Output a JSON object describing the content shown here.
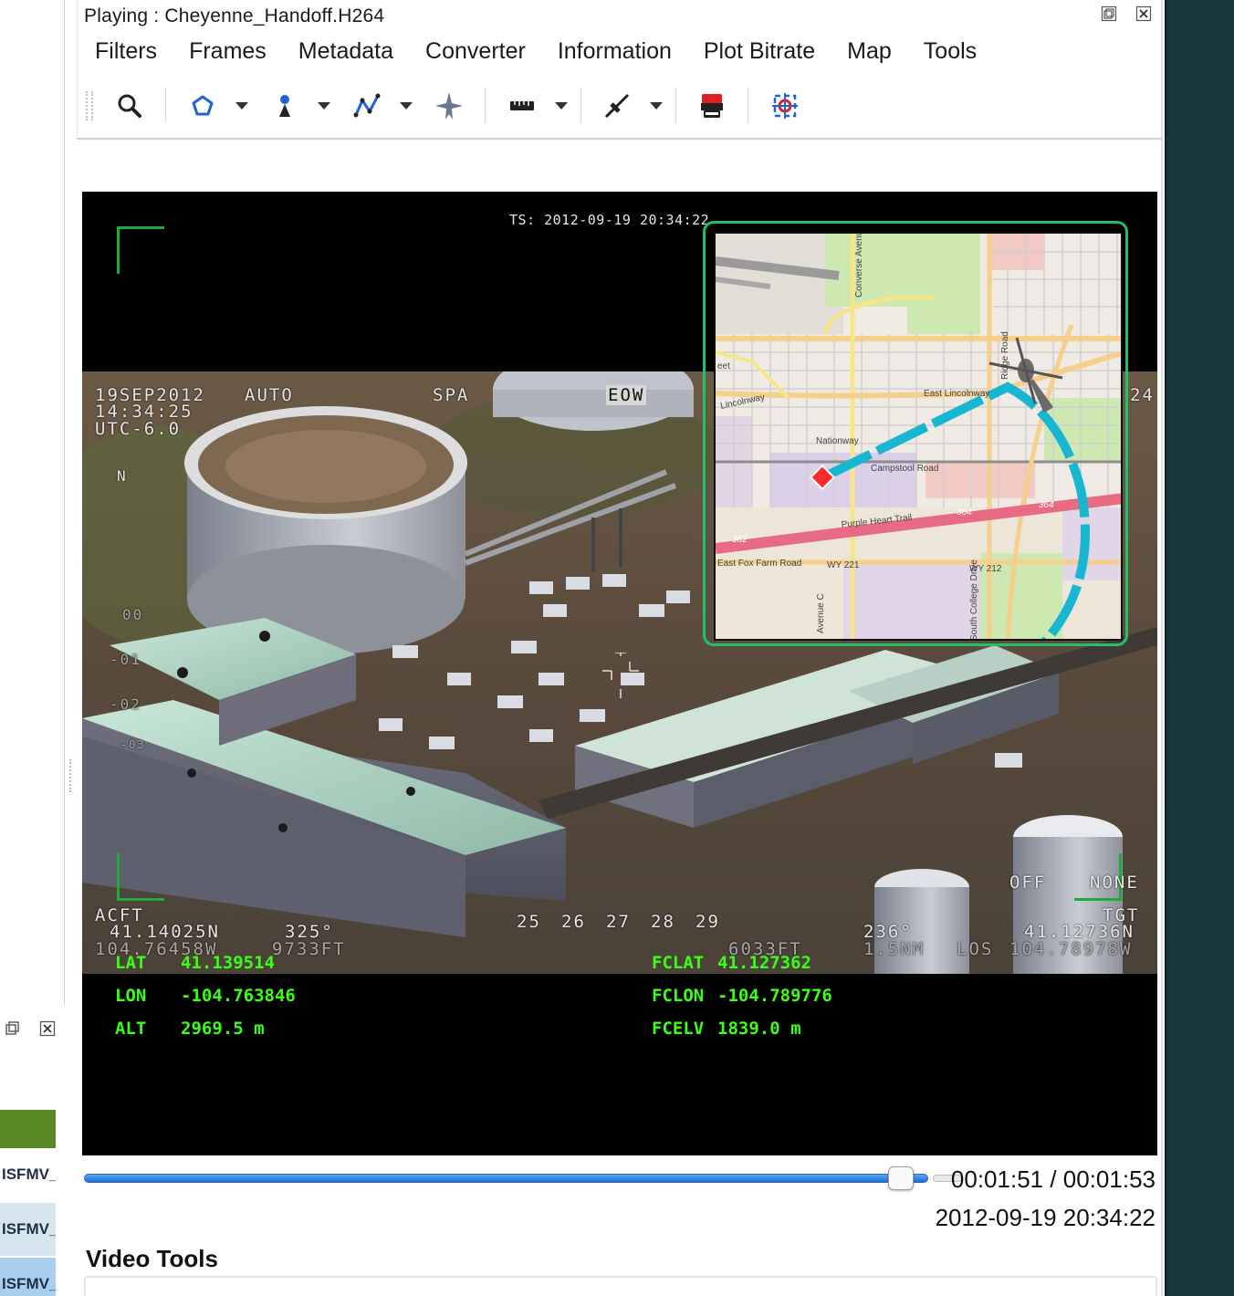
{
  "window": {
    "title": "Playing : Cheyenne_Handoff.H264",
    "restore_icon": "restore-icon",
    "close_icon": "close-icon"
  },
  "menu": [
    "Filters",
    "Frames",
    "Metadata",
    "Converter",
    "Information",
    "Plot Bitrate",
    "Map",
    "Tools"
  ],
  "toolbar": {
    "icons": [
      "magnifier-icon",
      "polygon-icon",
      "point-icon",
      "polyline-icon",
      "aircraft-icon",
      "ruler-icon",
      "line-tool-icon",
      "capture-icon",
      "crosshair-target-icon"
    ]
  },
  "osd": {
    "ts": "TS: 2012-09-19 20:34:22",
    "date": "19SEP2012",
    "mode": "AUTO",
    "time": "14:34:25",
    "utc": "UTC-6.0",
    "spa": "SPA",
    "sensor": "EOW",
    "right_edge": "24",
    "north": "N",
    "scale": [
      "00",
      "-01",
      "-02",
      "-03"
    ],
    "heading_ticks": [
      "25",
      "26",
      "27",
      "28",
      "29"
    ],
    "off": "OFF",
    "none": "NONE",
    "acft_label": "ACFT",
    "acft_lat": "41.14025N",
    "acft_lon": "104.76458W",
    "acft_heading": "325°",
    "acft_alt": "9733FT",
    "tgt_alt": "6033FT",
    "tgt_bearing": "236°",
    "tgt_range": "1.5NM",
    "los": "LOS",
    "tgt_label": "TGT",
    "tgt_lat": "41.12736N",
    "tgt_lon": "104.78978W"
  },
  "klv": {
    "lat_label": "LAT",
    "lat_value": "41.139514",
    "lon_label": "LON",
    "lon_value": "-104.763846",
    "alt_label": "ALT",
    "alt_value": "2969.5 m",
    "fclat_label": "FCLAT",
    "fclat_value": "41.127362",
    "fclon_label": "FCLON",
    "fclon_value": "-104.789776",
    "fcelv_label": "FCELV",
    "fcelv_value": "1839.0 m"
  },
  "minimap": {
    "streets": [
      "Converse Avenue",
      "Ridge Road",
      "East Lincolnway",
      "Lincolnway",
      "Nationway",
      "Campstool Road",
      "Purple Heart Trail",
      "East Fox Farm Road",
      "WY 221",
      "WY 212",
      "South College Drive",
      "Avenue C",
      "eet"
    ],
    "route_numbers": [
      "364",
      "364",
      "362"
    ],
    "colors": {
      "route": "#18b6d0",
      "target": "#ff2a2a",
      "highway": "#e76b83",
      "frame": "#23c06a"
    }
  },
  "playback": {
    "progress": 0.9823,
    "time": "00:01:51 / 00:01:53",
    "timestamp": "2012-09-19 20:34:22"
  },
  "video_tools": {
    "label": "Video Tools"
  },
  "left_dock": {
    "rows": [
      "ISFMV_",
      "ISFMV_",
      "ISFMV_"
    ],
    "colors": {
      "header": "#5a8a26",
      "row_selected": "#a9cfee",
      "row_alt": "#d6e6ef"
    }
  }
}
